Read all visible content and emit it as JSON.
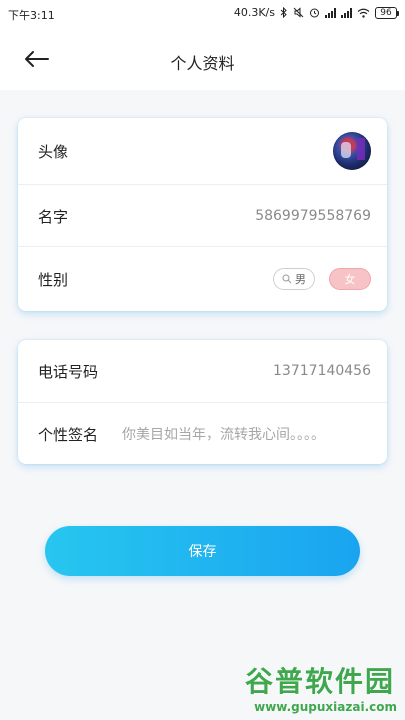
{
  "status_bar": {
    "time": "下午3:11",
    "speed": "40.3K/s",
    "battery": "96"
  },
  "nav": {
    "title": "个人资料"
  },
  "profile": {
    "avatar_label": "头像",
    "name_label": "名字",
    "name_value": "5869979558769",
    "gender_label": "性别",
    "gender_options": [
      "男",
      "女"
    ],
    "gender_selected": "女"
  },
  "contact": {
    "phone_label": "电话号码",
    "phone_value": "13717140456",
    "signature_label": "个性签名",
    "signature_value": "你美目如当年，流转我心间。。。。"
  },
  "save_button_label": "保存",
  "watermark": {
    "title": "谷普软件园",
    "url": "www.gupuxiazai.com"
  },
  "colors": {
    "accent_gradient_start": "#27c6ef",
    "accent_gradient_end": "#1aa4f0",
    "female_selected": "#f7c3c6"
  },
  "icons": [
    "back-arrow-icon",
    "bluetooth-icon",
    "mute-icon",
    "alarm-icon",
    "signal-icon",
    "wifi-icon",
    "battery-icon",
    "search-icon"
  ]
}
